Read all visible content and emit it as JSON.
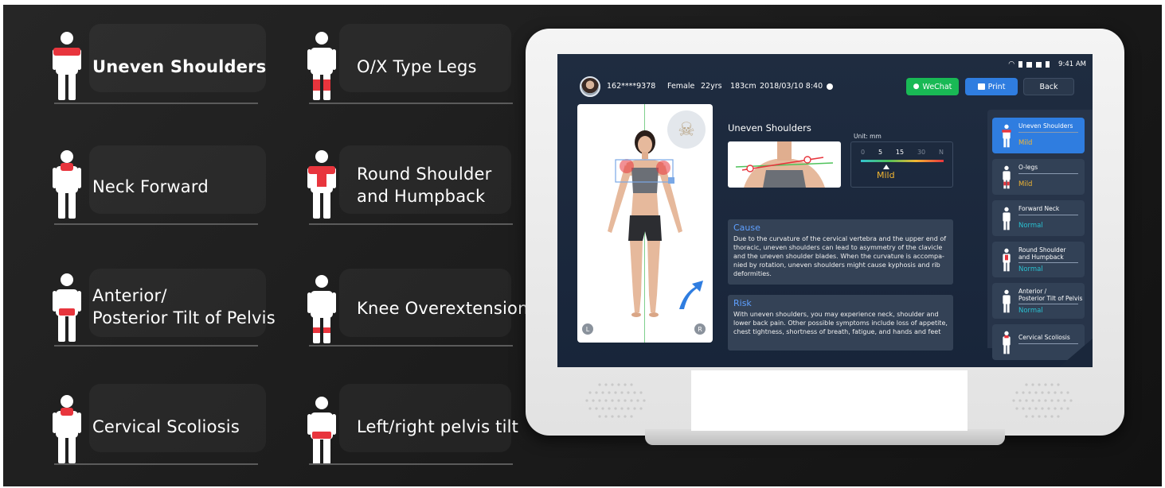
{
  "postures": [
    {
      "label": "Uneven Shoulders"
    },
    {
      "label": "O/X Type Legs"
    },
    {
      "label": "Neck Forward"
    },
    {
      "label_line1": "Round Shoulder",
      "label_line2": "and Humpback"
    },
    {
      "label_line1": "Anterior/",
      "label_line2": "Posterior Tilt of Pelvis"
    },
    {
      "label": "Knee Overextension"
    },
    {
      "label": "Cervical Scoliosis"
    },
    {
      "label": "Left/right pelvis tilt"
    }
  ],
  "device": {
    "status_bar": {
      "time": "9:41 AM"
    },
    "user": {
      "phone": "162****9378",
      "gender": "Female",
      "age": "22yrs",
      "height": "183cm",
      "datetime": "2018/03/10 8:40"
    },
    "buttons": {
      "wechat": "WeChat",
      "print": "Print",
      "back": "Back"
    },
    "photo_markers": {
      "left": "L",
      "right": "R"
    },
    "detail": {
      "title": "Uneven Shoulders",
      "unit": "Unit:  mm",
      "scale_ticks": [
        "0",
        "5",
        "15",
        "30",
        "N"
      ],
      "level": "Mild",
      "cause_title": "Cause",
      "cause_lines": [
        "Due to the curvature of the cervical vertebra and the upper end of",
        "thoracic, uneven shoulders can lead to asymmetry of the clavicle",
        "and the uneven shoulder blades. When the curvature is accompa-",
        "nied by rotation, uneven shoulders might cause kyphosis and rib",
        "deformities."
      ],
      "risk_title": "Risk",
      "risk_lines": [
        "With uneven shoulders, you may experience neck, shoulder and",
        "lower back pain. Other possible symptoms include loss of appetite,",
        "chest tightness, shortness of breath, fatigue, and hands and feet"
      ]
    },
    "sidebar": [
      {
        "line1": "Uneven Shoulders",
        "line2": "",
        "status": "Mild"
      },
      {
        "line1": "O-legs",
        "line2": "",
        "status": "Mild"
      },
      {
        "line1": "Forward Neck",
        "line2": "",
        "status": "Normal"
      },
      {
        "line1": "Round Shoulder",
        "line2": "and Humpback",
        "status": "Normal"
      },
      {
        "line1": "Anterior /",
        "line2": "Posterior Tilt of Pelvis",
        "status": "Normal"
      },
      {
        "line1": "Cervical Scoliosis",
        "line2": "",
        "status": ""
      }
    ],
    "colors": {
      "accent_blue": "#2f7de0",
      "wechat_green": "#19b955",
      "mild": "#f2b632",
      "normal": "#29c1d1",
      "highlight_red": "#e8353d"
    }
  }
}
